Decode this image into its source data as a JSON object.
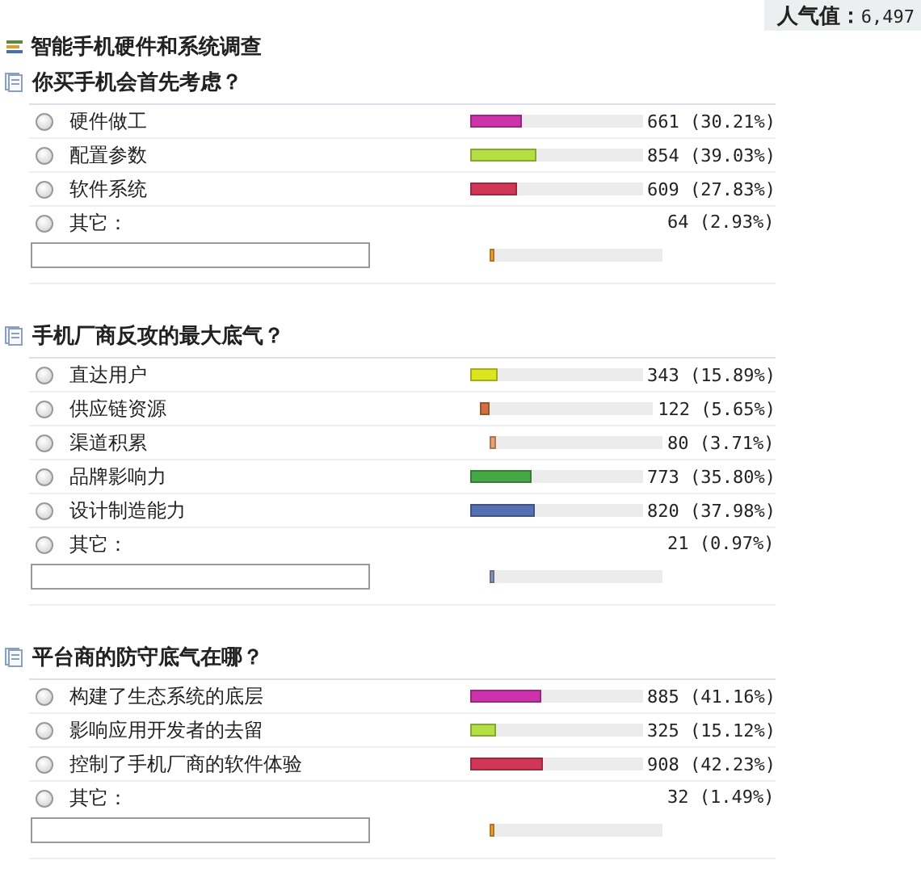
{
  "popularity": {
    "label": "人气值：",
    "value": "6,497"
  },
  "title": "智能手机硬件和系统调查",
  "questions": [
    {
      "title": "你买手机会首先考虑？",
      "options": [
        {
          "kind": "choice",
          "label": "硬件做工",
          "selected": false,
          "level": 0.3021,
          "color": "#cc33aa",
          "result": "661 (30.21%)"
        },
        {
          "kind": "choice",
          "label": "配置参数",
          "selected": false,
          "level": 0.3903,
          "color": "#b4e043",
          "result": "854 (39.03%)"
        },
        {
          "kind": "choice",
          "label": "软件系统",
          "selected": false,
          "level": 0.2783,
          "color": "#d03655",
          "result": "609 (27.83%)"
        },
        {
          "kind": "other",
          "label": "其它：",
          "selected": false,
          "level": 0.0293,
          "color": "#f0a030",
          "result": "64 (2.93%)"
        }
      ]
    },
    {
      "title": "手机厂商反攻的最大底气？",
      "options": [
        {
          "kind": "choice",
          "label": "直达用户",
          "selected": false,
          "level": 0.1589,
          "color": "#dce61e",
          "result": "343 (15.89%)"
        },
        {
          "kind": "choice",
          "label": "供应链资源",
          "selected": false,
          "level": 0.0565,
          "color": "#d0703c",
          "result": "122 (5.65%)"
        },
        {
          "kind": "choice",
          "label": "渠道积累",
          "selected": false,
          "level": 0.0371,
          "color": "#e8a070",
          "result": "80 (3.71%)"
        },
        {
          "kind": "choice",
          "label": "品牌影响力",
          "selected": false,
          "level": 0.358,
          "color": "#44a844",
          "result": "773 (35.80%)"
        },
        {
          "kind": "choice",
          "label": "设计制造能力",
          "selected": false,
          "level": 0.3798,
          "color": "#5470b0",
          "result": "820 (37.98%)"
        },
        {
          "kind": "other",
          "label": "其它：",
          "selected": false,
          "level": 0.0097,
          "color": "#8898b8",
          "result": "21 (0.97%)"
        }
      ]
    },
    {
      "title": "平台商的防守底气在哪？",
      "options": [
        {
          "kind": "choice",
          "label": "构建了生态系统的底层",
          "selected": false,
          "level": 0.4116,
          "color": "#cc33aa",
          "result": "885 (41.16%)"
        },
        {
          "kind": "choice",
          "label": "影响应用开发者的去留",
          "selected": false,
          "level": 0.1512,
          "color": "#b4e043",
          "result": "325 (15.12%)"
        },
        {
          "kind": "choice",
          "label": "控制了手机厂商的软件体验",
          "selected": false,
          "level": 0.4223,
          "color": "#d03655",
          "result": "908 (42.23%)"
        },
        {
          "kind": "other",
          "label": "其它：",
          "selected": false,
          "level": 0.0149,
          "color": "#f0a030",
          "result": "32 (1.49%)"
        }
      ]
    }
  ]
}
